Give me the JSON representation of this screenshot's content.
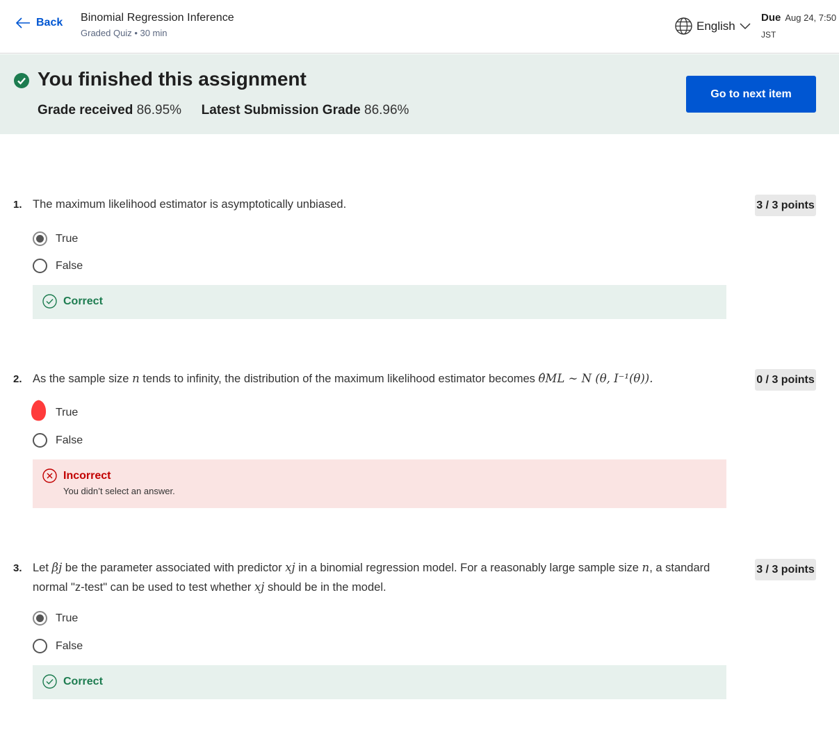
{
  "header": {
    "back_label": "Back",
    "title": "Binomial Regression Inference",
    "subtitle": "Graded Quiz • 30 min",
    "language": "English",
    "due_label": "Due",
    "due_date": "Aug 24, 7:50",
    "due_tz": "JST"
  },
  "banner": {
    "title": "You finished this assignment",
    "grade_label": "Grade received",
    "grade_value": "86.95%",
    "latest_label": "Latest Submission Grade",
    "latest_value": "86.96%",
    "next_button": "Go to next item"
  },
  "questions": [
    {
      "number": "1.",
      "text": "The maximum likelihood estimator is asymptotically unbiased.",
      "points": "3 / 3 points",
      "options": [
        "True",
        "False"
      ],
      "selected": "True",
      "feedback": "Correct",
      "feedback_detail": ""
    },
    {
      "number": "2.",
      "text_before": "As the sample size ",
      "text_var": "n",
      "text_middle": " tends to infinity, the distribution of the maximum likelihood estimator becomes ",
      "text_formula": "θ̂ML ∼ N (θ, I⁻¹(θ)).",
      "points": "0 / 3 points",
      "options": [
        "True",
        "False"
      ],
      "selected": "",
      "feedback": "Incorrect",
      "feedback_detail": "You didn’t select an answer."
    },
    {
      "number": "3.",
      "text_a": "Let ",
      "var_beta": "βj",
      "text_b": " be the parameter associated with predictor ",
      "var_x": "xj",
      "text_c": " in a binomial regression model. For a reasonably large sample size ",
      "var_n": "n",
      "text_d": ", a standard normal \"z-test\" can be used to test whether ",
      "var_x2": "xj",
      "text_e": " should be in the model.",
      "points": "3 / 3 points",
      "options": [
        "True",
        "False"
      ],
      "selected": "True",
      "feedback": "Correct",
      "feedback_detail": ""
    }
  ],
  "colors": {
    "accent": "#0056d2",
    "banner_bg": "#e7efec",
    "correct": "#1d7c50",
    "incorrect": "#c20000",
    "incorrect_bg": "#fae4e3",
    "annotation": "#ff3b3b"
  },
  "icons": [
    "arrow-left-icon",
    "globe-icon",
    "chevron-down-icon",
    "check-circle-icon",
    "x-circle-icon"
  ]
}
